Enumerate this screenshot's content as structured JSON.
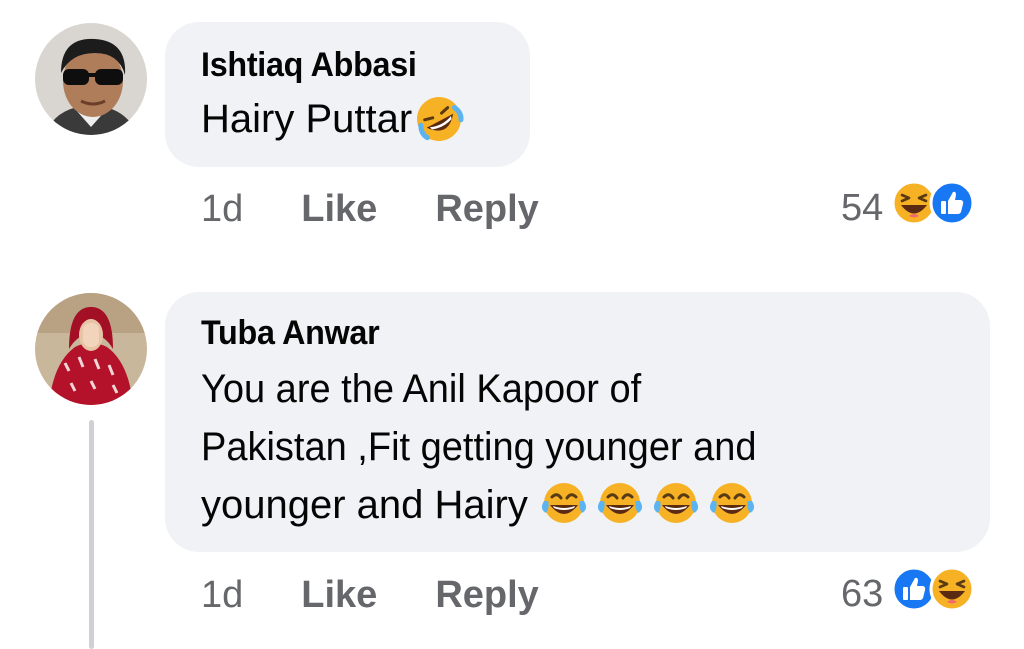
{
  "colors": {
    "bubble": "#f0f2f5",
    "meta_text": "#65676b",
    "like_blue": "#1877f2",
    "haha_yellow": "#f7b125"
  },
  "comments": [
    {
      "author": "Ishtiaq Abbasi",
      "text_lines": [
        "Hairy Puttar"
      ],
      "inline_emoji": [
        "rolling-laughing-emoji"
      ],
      "time": "1d",
      "like_label": "Like",
      "reply_label": "Reply",
      "reaction_count": "54",
      "reaction_icons": [
        "haha-reaction-icon",
        "like-reaction-icon"
      ]
    },
    {
      "author": "Tuba Anwar",
      "text_lines": [
        "You are the Anil Kapoor of",
        "Pakistan ,Fit getting younger and",
        "younger and Hairy"
      ],
      "inline_emoji": [
        "tears-of-joy-emoji",
        "tears-of-joy-emoji",
        "tears-of-joy-emoji",
        "tears-of-joy-emoji"
      ],
      "time": "1d",
      "like_label": "Like",
      "reply_label": "Reply",
      "reaction_count": "63",
      "reaction_icons": [
        "like-reaction-icon",
        "haha-reaction-icon"
      ]
    }
  ]
}
